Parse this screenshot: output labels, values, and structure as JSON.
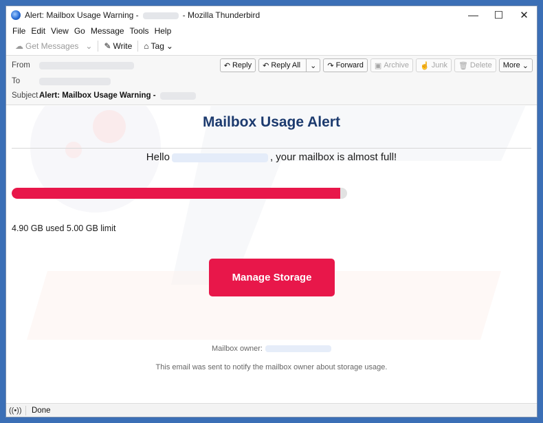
{
  "window": {
    "title_prefix": "Alert: Mailbox Usage Warning -",
    "title_suffix": "- Mozilla Thunderbird",
    "controls": {
      "minimize": "—",
      "maximize": "☐",
      "close": "✕"
    }
  },
  "menu": [
    "File",
    "Edit",
    "View",
    "Go",
    "Message",
    "Tools",
    "Help"
  ],
  "toolbar": {
    "get_messages": "Get Messages",
    "write": "Write",
    "tag": "Tag"
  },
  "headers": {
    "from_label": "From",
    "to_label": "To",
    "subject_label": "Subject",
    "subject_value": "Alert: Mailbox Usage Warning -"
  },
  "actions": {
    "reply": "Reply",
    "reply_all": "Reply All",
    "forward": "Forward",
    "archive": "Archive",
    "junk": "Junk",
    "delete": "Delete",
    "more": "More"
  },
  "email": {
    "title": "Mailbox Usage Alert",
    "greeting_prefix": "Hello",
    "greeting_suffix": ", your mailbox is almost full!",
    "progress_fraction": 0.98,
    "usage_text": "4.90 GB used 5.00 GB limit",
    "cta_label": "Manage Storage",
    "owner_label": "Mailbox owner:",
    "note": "This email was sent to notify the mailbox owner about storage usage."
  },
  "status": {
    "text": "Done"
  },
  "colors": {
    "accent": "#e8174a",
    "title_blue": "#1c3a6e"
  }
}
